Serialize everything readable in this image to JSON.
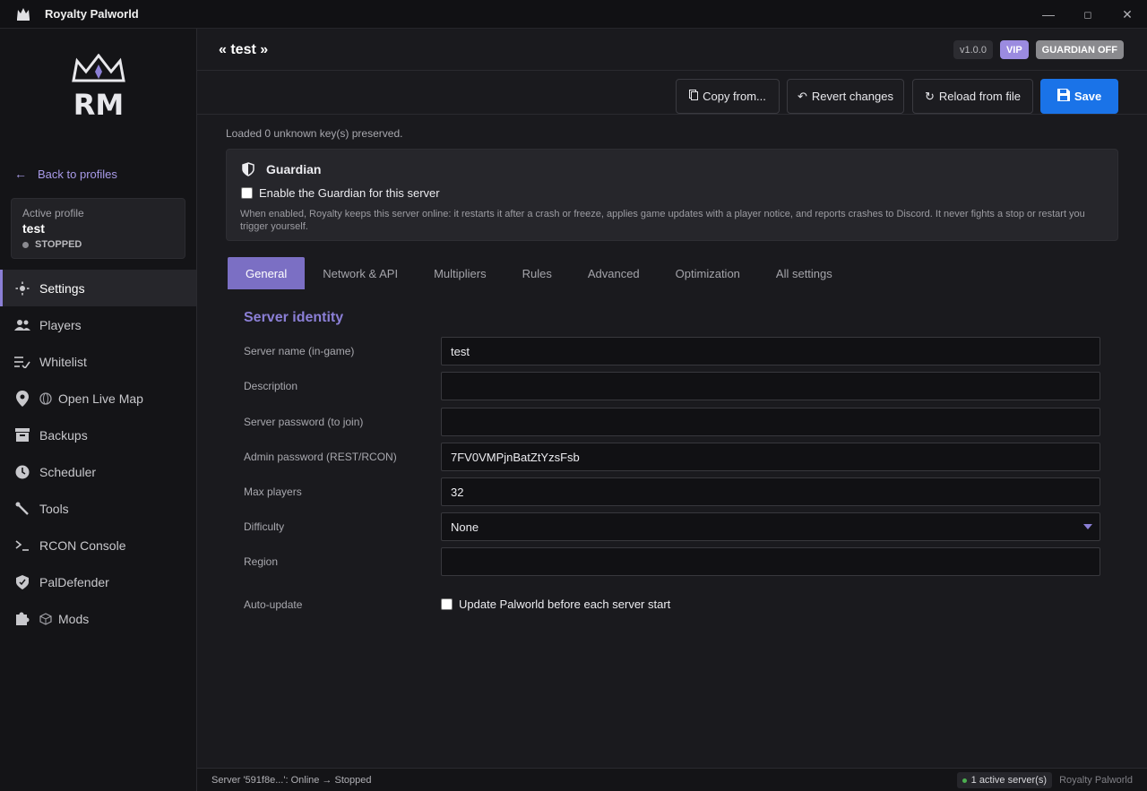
{
  "app": {
    "title": "Royalty Palworld"
  },
  "window": {
    "minimize": "—",
    "maximize": "◻",
    "close": "✕"
  },
  "sidebar": {
    "back_label": "Back to profiles",
    "profile": {
      "label": "Active profile",
      "name": "test",
      "status": "STOPPED"
    },
    "items": [
      {
        "label": "Settings",
        "icon": "gear-icon"
      },
      {
        "label": "Players",
        "icon": "users-icon"
      },
      {
        "label": "Whitelist",
        "icon": "checklist-icon"
      },
      {
        "label": "Open Live Map",
        "icon": "map-pin-icon"
      },
      {
        "label": "Backups",
        "icon": "archive-icon"
      },
      {
        "label": "Scheduler",
        "icon": "clock-icon"
      },
      {
        "label": "Tools",
        "icon": "wrench-icon"
      },
      {
        "label": "RCON Console",
        "icon": "terminal-icon"
      },
      {
        "label": "PalDefender",
        "icon": "shield-icon"
      },
      {
        "label": "Mods",
        "icon": "puzzle-icon"
      }
    ]
  },
  "header": {
    "title": "« test »",
    "version": "v1.0.0",
    "vip": "VIP",
    "guardian_badge": "GUARDIAN OFF"
  },
  "toolbar": {
    "copy_label": "Copy from...",
    "revert_label": "Revert changes",
    "reload_label": "Reload from file",
    "save_label": "Save"
  },
  "content": {
    "loaded_note": "Loaded 0 unknown key(s) preserved.",
    "guardian": {
      "title": "Guardian",
      "checkbox_label": "Enable the Guardian for this server",
      "description": "When enabled, Royalty keeps this server online: it restarts it after a crash or freeze, applies game updates with a player notice, and reports crashes to Discord. It never fights a stop or restart you trigger yourself."
    },
    "tabs": [
      "General",
      "Network & API",
      "Multipliers",
      "Rules",
      "Advanced",
      "Optimization",
      "All settings"
    ],
    "section_title": "Server identity",
    "fields": {
      "server_name": {
        "label": "Server name (in-game)",
        "value": "test"
      },
      "description": {
        "label": "Description",
        "value": ""
      },
      "server_password": {
        "label": "Server password (to join)",
        "value": ""
      },
      "admin_password": {
        "label": "Admin password (REST/RCON)",
        "value": "7FV0VMPjnBatZtYzsFsb"
      },
      "max_players": {
        "label": "Max players",
        "value": "32"
      },
      "difficulty": {
        "label": "Difficulty",
        "value": "None"
      },
      "region": {
        "label": "Region",
        "value": ""
      },
      "auto_update": {
        "label": "Auto-update",
        "checkbox_label": "Update Palworld before each server start"
      }
    }
  },
  "statusbar": {
    "message": "Server '591f8e...': Online → Stopped",
    "active_servers": "1 active server(s)",
    "brand": "Royalty Palworld"
  },
  "colors": {
    "accent": "#8b7fd6",
    "save": "#1a73e8",
    "sidebar_bg": "#141417",
    "main_bg": "#1a1a1e"
  }
}
